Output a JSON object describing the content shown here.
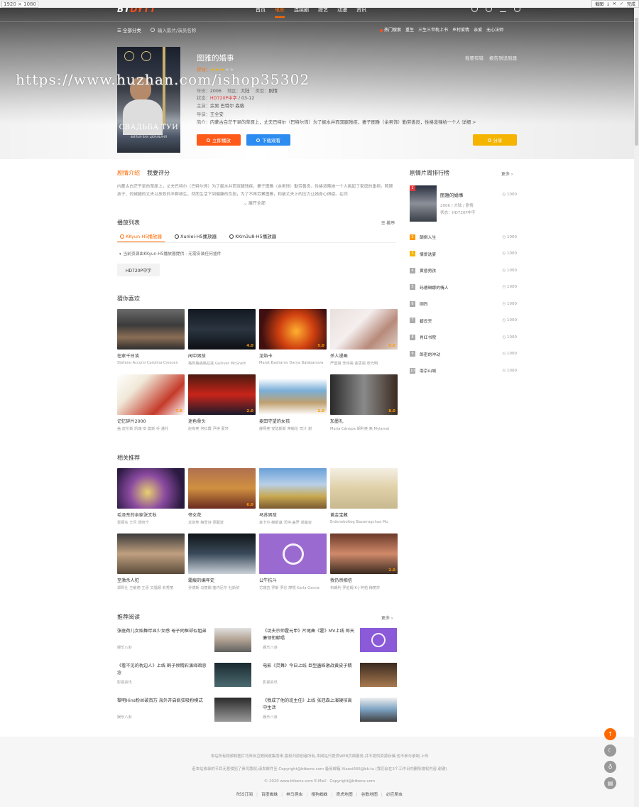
{
  "browser": {
    "size_label": "1920 × 1080",
    "actions": [
      "截图",
      "下载",
      "关闭",
      "完成"
    ]
  },
  "site": {
    "logo_main": "BT",
    "logo_accent": "DYTT",
    "nav": [
      "首页",
      "电影",
      "连续剧",
      "综艺",
      "动漫",
      "资讯"
    ],
    "nav_active": "电影",
    "nav_icons": [
      "history-icon",
      "message-icon",
      "chart-icon",
      "user-icon"
    ]
  },
  "subnav": {
    "all_categories": "☰ 全部分类",
    "search_placeholder": "输入影片/演员名称",
    "hot_label": "热门搜索",
    "hot_items": [
      "重生",
      "三生三世枕上书",
      "乡村爱情",
      "亲爱",
      "无心法师"
    ]
  },
  "movie": {
    "title": "图雅的婚事",
    "rating_text": "评分：",
    "stars_full": "★★★",
    "stars_empty": "★★",
    "year_label": "年份：",
    "year": "2006",
    "region_label": "地区：",
    "region": "大陆",
    "genre_label": "类型：",
    "genre": "剧情",
    "status_label": "状态：",
    "status": "HD720P中字",
    "update": " / 03-12",
    "cast_label": "主演：",
    "cast": "余男 巴特尔 森格",
    "director_label": "导演：",
    "director": "王全安",
    "summary_label": "简介：",
    "summary": "内蒙古白茫干旱的草原上，丈夫巴特尔（巴特尔饰）为了掘水井而双腿残疾，妻子图雅（余男饰）勤劳善良，性格泼辣给一个人 详细 >",
    "links": [
      "我要有错",
      "报告到追到器"
    ],
    "poster_title": "СВАДЬБА ТУИ",
    "poster_subtitle": "ФИЛЬМ ВАН ЦЮАНЬАНЯ"
  },
  "buttons": {
    "play": "立即播放",
    "download": "下载观看",
    "share": "分享"
  },
  "watermark": "https://www.huzhan.com/ishop35302",
  "intro_tabs": [
    "剧情介绍",
    "我要评分"
  ],
  "intro_text": "内蒙古白茫干旱的草原上，丈夫巴特尔（巴特尔饰）为了掘水井而双腿残疾，妻子图雅（余男饰）勤劳善良，性格泼辣她一个人挑起了家庭的重担。照顾孩子、伺候腿的丈夫以放牧的羊群维生，然而生活下到健康的负担，为了不再劳累图雅，和被丈夫上的压力让她身心俱疲。在同",
  "intro_more": "⌄ 展开全部",
  "playlist": {
    "title": "播放列表",
    "sort": "☰ 排序",
    "tabs": [
      "KKyun-H5播放器",
      "Xunlei-H5播放器",
      "KKm3u8-H5播放器"
    ],
    "notice": "当前资源由KKyun-H5播放器提供 - 无需安装任何插件",
    "episodes": [
      "HD720P中字"
    ]
  },
  "guess": {
    "title": "猜你喜欢",
    "items": [
      {
        "title": "在家千日谈",
        "actors": "Stefano Accorsi Carolina Crescen",
        "score": ""
      },
      {
        "title": "闲中男孩",
        "actors": "格列格森格拉兹 Gulliver McGrath",
        "score": "4.0"
      },
      {
        "title": "龙焰卡",
        "actors": "Marat Basharov Darya Balabanova",
        "score": "5.0"
      },
      {
        "title": "杀人漫画",
        "actors": "严曼丽 李诗亮 金思祖 张光明",
        "score": "5.0"
      },
      {
        "title": "记忆碎片2000",
        "actors": "盖·皮尔斯 凯瑞·安·莫斯 乔·潘托",
        "score": "7.6"
      },
      {
        "title": "迷色骨头",
        "actors": "赵有亮 何红霞 尹铮 夏轩",
        "score": "2.0"
      },
      {
        "title": "麦田守望的女孩",
        "actors": "薛熙亮 安陆斯斯 蒋翰伦 司汁 谢",
        "score": "2.0"
      },
      {
        "title": "加墨礼",
        "actors": "Maria Cánepa 胡利奥 高 Mylamal",
        "score": "8.0"
      }
    ]
  },
  "related": {
    "title": "相关推荐",
    "items": [
      {
        "title": "毛泽东的亲家张文秋",
        "actors": "雷振东 王月 郭晓宁",
        "score": ""
      },
      {
        "title": "帝女花",
        "actors": "龙剑笙 梅雪诗 梁醒波",
        "score": "6.0"
      },
      {
        "title": "马苏男孩",
        "actors": "富卡尔·赫斯基 沃特·盖罗 诺基亚",
        "score": ""
      },
      {
        "title": "黄金宝藏",
        "actors": "Erdenebolteg Bazarragchaa Mu",
        "score": ""
      },
      {
        "title": "至激杀人犯",
        "actors": "郑则仕 王敏德 王喜 文福顺 俞秀丽",
        "score": ""
      },
      {
        "title": "霜痕的编年史",
        "actors": "孙德斯 马丽娜 塞内尼尔 杜斯依",
        "score": ""
      },
      {
        "title": "公牛抗斗",
        "actors": "尤瑞吉 罗斯 罗伦 摩根 Karla Garcia",
        "score": ""
      },
      {
        "title": "我仍然相信",
        "actors": "布朗利 罗伯姆 K·J·阿帕 梅丽莎",
        "score": "2.0"
      }
    ]
  },
  "news": {
    "title": "推荐阅读",
    "more": "更多 ›",
    "items": [
      {
        "title": "张庭荷儿女贻舞尽显少女感 母子同框却似姐弟",
        "cat": "娱乐八卦"
      },
      {
        "title": "《功夫宗师霍元甲》片尾曲《霍》MV上线 郎天廉领衔献唱",
        "cat": "娱乐八卦"
      },
      {
        "title": "《看不见的枕边人》上线 鹤子倾精彩演绎暗恶念",
        "cat": "影视资讯"
      },
      {
        "title": "电影《灵舞》今日上线 巨型蛊蛛激战黄皮子精",
        "cat": "影视资讯"
      },
      {
        "title": "黎明Hins粉丝破百万 海外开启疯狂吸粉模式",
        "cat": "娱乐八卦"
      },
      {
        "title": "《我成了他的班主任》上线 张冠森上演硬核高中生活",
        "cat": "娱乐八卦"
      }
    ]
  },
  "ranking": {
    "title": "剧情片周排行榜",
    "more": "更多 ›",
    "top": {
      "rank": "1",
      "name": "图雅的婚事",
      "info1": "2006 / 大陆 / 剧情",
      "info2": "状态：HD720P中字",
      "views": "1000"
    },
    "items": [
      {
        "rank": "2",
        "name": "颠倒人生",
        "views": "1000"
      },
      {
        "rank": "3",
        "name": "情爱选宴",
        "views": "1000"
      },
      {
        "rank": "4",
        "name": "黄昏男孩",
        "views": "1000"
      },
      {
        "rank": "5",
        "name": "玛德琳娜的情人",
        "views": "1000"
      },
      {
        "rank": "6",
        "name": "刚烈",
        "views": "1000"
      },
      {
        "rank": "7",
        "name": "碧云天",
        "views": "1000"
      },
      {
        "rank": "8",
        "name": "肖红书院",
        "views": "1000"
      },
      {
        "rank": "9",
        "name": "郎密的冲动",
        "views": "1000"
      },
      {
        "rank": "10",
        "name": "南京山城",
        "views": "1000"
      }
    ]
  },
  "footer": {
    "line1": "本站所有视频和图片均来自互联网收集而来,版权归原创者所有,本网站只提供WEB页面服务,并不提供资源存储,也不参与录制,上传",
    "line2": "若本站收录的节目无意侵犯了贵司版权,请发邮件至 Copyright@btbenx.com 备用邮箱 Xiaoxi666@bk.tu (我们会在3个工作日内删除侵权内容,谢谢)",
    "line3": "© 2020 www.btbenx.com  E-Mail：Copyright@btbenx.com",
    "links": [
      "RSS订阅",
      "百度蜘蛛",
      "神马爬虫",
      "搜狗蜘蛛",
      "奇虎地图",
      "谷歌地图",
      "必应爬虫"
    ]
  },
  "float_buttons": [
    "↑",
    "☾",
    "♁",
    "▤"
  ]
}
